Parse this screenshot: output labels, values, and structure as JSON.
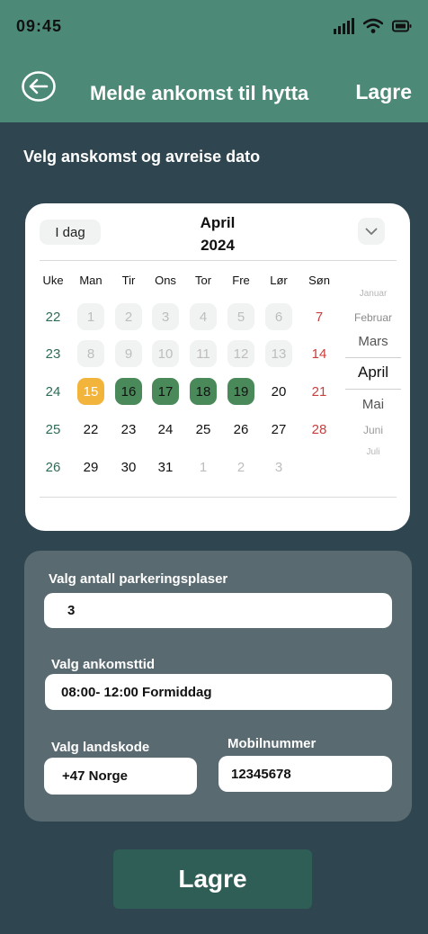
{
  "status_bar": {
    "time": "09:45"
  },
  "header": {
    "title": "Melde ankomst til hytta",
    "save_label": "Lagre"
  },
  "subtitle": "Velg anskomst og avreise dato",
  "calendar": {
    "today_label": "I dag",
    "month": "April",
    "year": "2024",
    "weekday_headers": [
      "Uke",
      "Man",
      "Tir",
      "Ons",
      "Tor",
      "Fre",
      "Lør",
      "Søn"
    ],
    "weeks": [
      {
        "week": "22",
        "days": [
          "1",
          "2",
          "3",
          "4",
          "5",
          "6",
          "7"
        ]
      },
      {
        "week": "23",
        "days": [
          "8",
          "9",
          "10",
          "11",
          "12",
          "13",
          "14"
        ]
      },
      {
        "week": "24",
        "days": [
          "15",
          "16",
          "17",
          "18",
          "19",
          "20",
          "21"
        ]
      },
      {
        "week": "25",
        "days": [
          "22",
          "23",
          "24",
          "25",
          "26",
          "27",
          "28"
        ]
      },
      {
        "week": "26",
        "days": [
          "29",
          "30",
          "31",
          "1",
          "2",
          "3",
          ""
        ]
      }
    ],
    "selected_start": "15",
    "selected_range": [
      "16",
      "17",
      "18",
      "19"
    ],
    "month_picker": [
      "Januar",
      "Februar",
      "Mars",
      "April",
      "Mai",
      "Juni",
      "Juli"
    ],
    "month_picker_selected": "April"
  },
  "form": {
    "parking_label": "Valg antall parkeringsplaser",
    "parking_value": "3",
    "arrival_time_label": "Valg ankomsttid",
    "arrival_time_value": "08:00- 12:00 Formiddag",
    "country_code_label": "Valg landskode",
    "country_code_value": "+47  Norge",
    "mobile_label": "Mobilnummer",
    "mobile_value": "12345678"
  },
  "save_button": "Lagre",
  "colors": {
    "background": "#2f4650",
    "header": "#4c8a77",
    "range_day": "#4a8a5a",
    "start_day": "#f3b43c",
    "sunday": "#c73e3e",
    "week_number": "#2e6b57",
    "save_button": "#2f5e56"
  }
}
